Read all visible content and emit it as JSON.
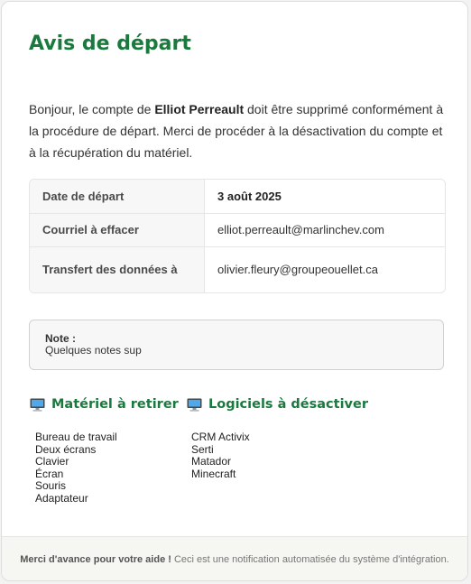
{
  "title": "Avis de départ",
  "intro": {
    "before": "Bonjour, le compte de ",
    "name": "Elliot Perreault",
    "after": " doit être supprimé conformément à la procédure de départ. Merci de procéder à la désactivation du compte et à la récupération du matériel."
  },
  "info_rows": [
    {
      "label": "Date de départ",
      "value": "3 août 2025"
    },
    {
      "label": "Courriel à effacer",
      "value": "elliot.perreault@marlinchev.com"
    },
    {
      "label": "Transfert des données à",
      "value": "olivier.fleury@groupeouellet.ca"
    }
  ],
  "note": {
    "label": "Note :",
    "text": "Quelques notes sup"
  },
  "hardware": {
    "title": "Matériel à retirer",
    "icon": "computer-icon",
    "items": [
      "Bureau de travail",
      "Deux écrans",
      "Clavier",
      "Écran",
      "Souris",
      "Adaptateur"
    ]
  },
  "software": {
    "title": "Logiciels à désactiver",
    "icon": "computer-icon",
    "items": [
      "CRM Activix",
      "Serti",
      "Matador",
      "Minecraft"
    ]
  },
  "footer": {
    "thanks": "Merci d'avance pour votre aide !",
    "note": "Ceci est une notification automatisée du système d'intégration."
  },
  "colors": {
    "accent": "#1a7a3e",
    "background": "#f2f3f2"
  }
}
